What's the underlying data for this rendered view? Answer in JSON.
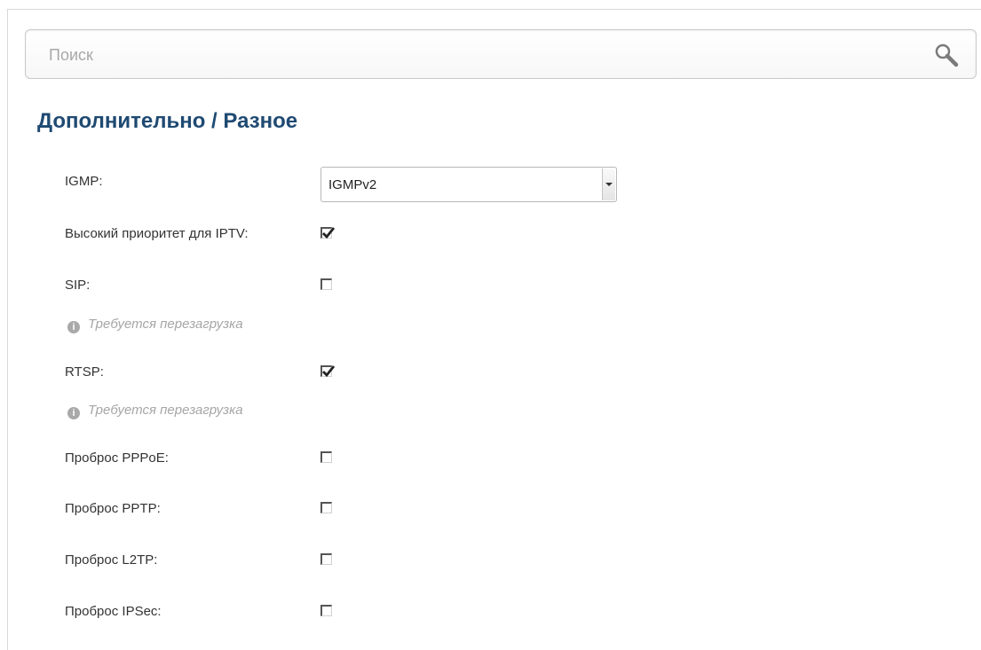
{
  "search": {
    "placeholder": "Поиск",
    "value": "",
    "icon": "search-icon"
  },
  "breadcrumb": {
    "section": "Дополнительно",
    "separator": " / ",
    "page": "Разное"
  },
  "igmp": {
    "label": "IGMP:",
    "selected": "IGMPv2"
  },
  "settings": [
    {
      "id": "iptv-priority",
      "label": "Высокий приоритет для IPTV:",
      "checked": true
    },
    {
      "id": "sip",
      "label": "SIP:",
      "checked": false,
      "notice": "Требуется перезагрузка"
    },
    {
      "id": "rtsp",
      "label": "RTSP:",
      "checked": true,
      "notice": "Требуется перезагрузка"
    },
    {
      "id": "pppoe-passthrough",
      "label": "Проброс PPPoE:",
      "checked": false
    },
    {
      "id": "pptp-passthrough",
      "label": "Проброс PPTP:",
      "checked": false
    },
    {
      "id": "l2tp-passthrough",
      "label": "Проброс L2TP:",
      "checked": false
    },
    {
      "id": "ipsec-passthrough",
      "label": "Проброс IPSec:",
      "checked": false
    }
  ],
  "icons": {
    "notice": "info-icon",
    "checked": "checkmark-icon"
  },
  "colors": {
    "title": "#1f4a72",
    "label": "#333333",
    "notice": "#a6a6a6"
  }
}
